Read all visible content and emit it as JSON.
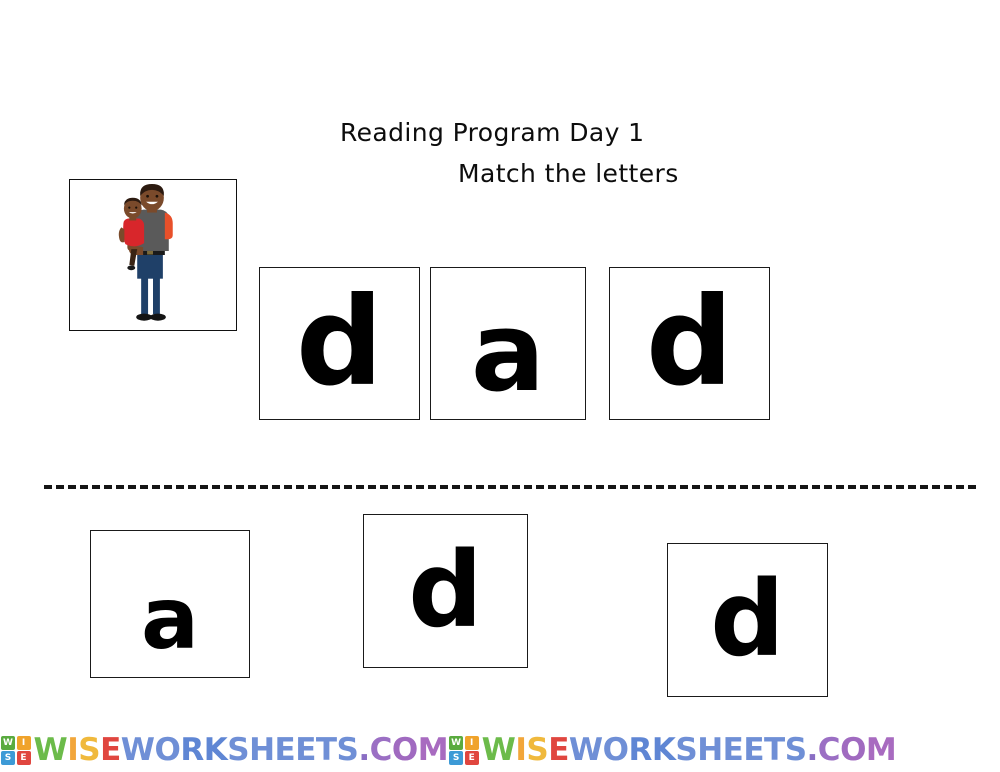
{
  "worksheet": {
    "title_line_1": "Reading Program Day 1",
    "title_line_2": "Match the letters",
    "picture": {
      "alt": "dad-holding-child",
      "colors": {
        "skin": "#7a4a2b",
        "skin_dark": "#5d3820",
        "hair": "#2c1a10",
        "shirt": "#5a5a5a",
        "sleeve": "#e8502a",
        "child_shirt": "#d8262b",
        "jeans": "#1f4068",
        "belt": "#1a1a1a",
        "shoes": "#141414"
      }
    },
    "top_row": {
      "label": "answer-key-row",
      "cards": [
        {
          "letter": "d"
        },
        {
          "letter": "a"
        },
        {
          "letter": "d"
        }
      ]
    },
    "bottom_row": {
      "label": "draggable-letter-row",
      "cards": [
        {
          "letter": "a"
        },
        {
          "letter": "d"
        },
        {
          "letter": "d"
        }
      ]
    },
    "divider": {
      "style": "dashed"
    }
  },
  "watermark": {
    "logo_letters": [
      {
        "char": "W",
        "color": "#5aab3f"
      },
      {
        "char": "I",
        "color": "#f0a32b"
      },
      {
        "char": "S",
        "color": "#3d9ad6"
      },
      {
        "char": "E",
        "color": "#e0463f"
      }
    ],
    "text_letters": [
      {
        "char": "W",
        "color": "#6cbb4a"
      },
      {
        "char": "I",
        "color": "#f2a63a"
      },
      {
        "char": "S",
        "color": "#f0b93c"
      },
      {
        "char": "E",
        "color": "#e0463f"
      },
      {
        "char": "W",
        "color": "#6f8fd6"
      },
      {
        "char": "O",
        "color": "#6f8fd6"
      },
      {
        "char": "R",
        "color": "#5f86d4"
      },
      {
        "char": "K",
        "color": "#5f86d4"
      },
      {
        "char": "S",
        "color": "#6f8fd6"
      },
      {
        "char": "H",
        "color": "#6f8fd6"
      },
      {
        "char": "E",
        "color": "#6f8fd6"
      },
      {
        "char": "E",
        "color": "#6f8fd6"
      },
      {
        "char": "T",
        "color": "#6f8fd6"
      },
      {
        "char": "S",
        "color": "#6f8fd6"
      },
      {
        "char": ".",
        "color": "#8a6ec4"
      },
      {
        "char": "C",
        "color": "#9b6fc4"
      },
      {
        "char": "O",
        "color": "#a06ac0"
      },
      {
        "char": "M",
        "color": "#a86bc0"
      }
    ],
    "full_text": "WISEWORKSHEETS.COM",
    "instances": 2
  }
}
